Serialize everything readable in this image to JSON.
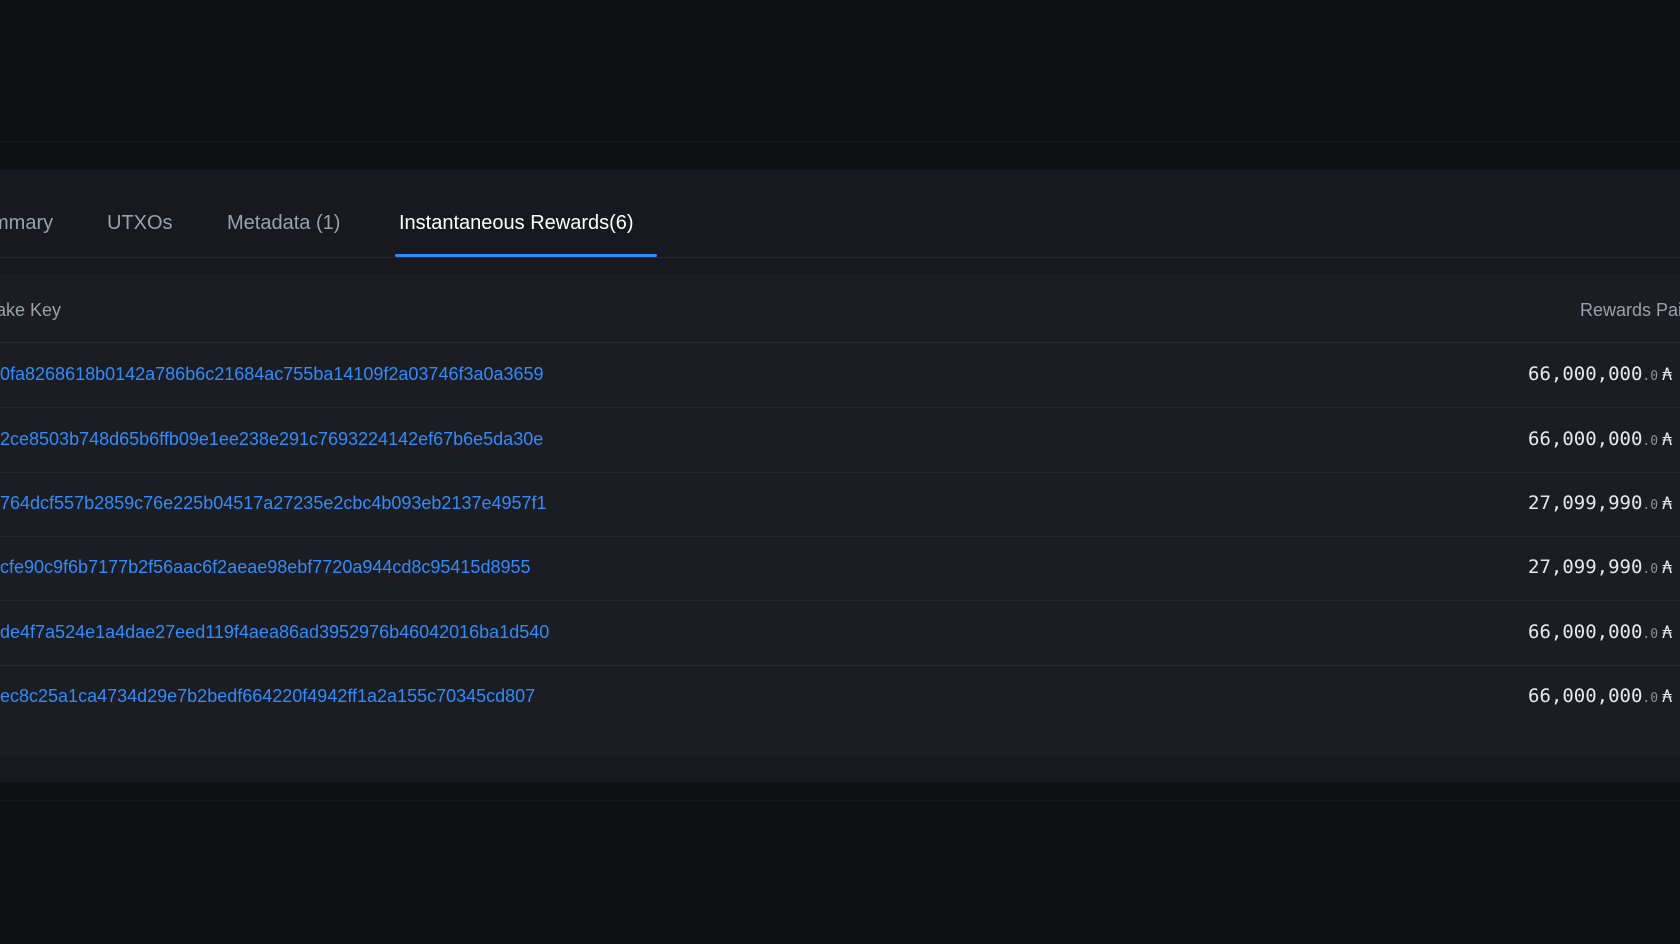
{
  "tabs": [
    {
      "label": "mmary",
      "active": false
    },
    {
      "label": "UTXOs",
      "active": false
    },
    {
      "label": "Metadata (1)",
      "active": false
    },
    {
      "label": "Instantaneous Rewards(6)",
      "active": true
    }
  ],
  "table": {
    "headers": {
      "stake_key": "take Key",
      "rewards_paid": "Rewards Pai"
    },
    "rows": [
      {
        "stake_key": "0fa8268618b0142a786b6c21684ac755ba14109f2a03746f3a0a3659",
        "amount": "66,000,000",
        "decimal": ".0",
        "symbol": "₳"
      },
      {
        "stake_key": "2ce8503b748d65b6ffb09e1ee238e291c7693224142ef67b6e5da30e",
        "amount": "66,000,000",
        "decimal": ".0",
        "symbol": "₳"
      },
      {
        "stake_key": "764dcf557b2859c76e225b04517a27235e2cbc4b093eb2137e4957f1",
        "amount": "27,099,990",
        "decimal": ".0",
        "symbol": "₳"
      },
      {
        "stake_key": "cfe90c9f6b7177b2f56aac6f2aeae98ebf7720a944cd8c95415d8955",
        "amount": "27,099,990",
        "decimal": ".0",
        "symbol": "₳"
      },
      {
        "stake_key": "de4f7a524e1a4dae27eed119f4aea86ad3952976b46042016ba1d540",
        "amount": "66,000,000",
        "decimal": ".0",
        "symbol": "₳"
      },
      {
        "stake_key": "ec8c25a1ca4734d29e7b2bedf664220f4942ff1a2a155c70345cd807",
        "amount": "66,000,000",
        "decimal": ".0",
        "symbol": "₳"
      }
    ]
  },
  "colors": {
    "accent": "#2f8cff",
    "background": "#0e1014",
    "panel": "#17191e",
    "table": "#1b1d23"
  }
}
